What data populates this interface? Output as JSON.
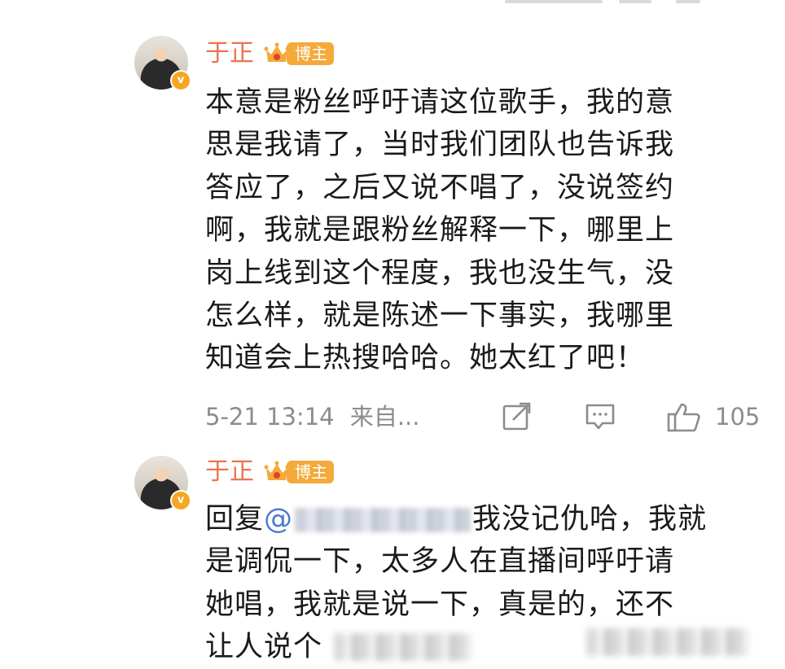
{
  "comments": [
    {
      "username": "于正",
      "badge_label": "博主",
      "text": "本意是粉丝呼吁请这位歌手，我的意思是我请了，当时我们团队也告诉我答应了，之后又说不唱了，没说签约啊，我就是跟粉丝解释一下，哪里上岗上线到这个程度，我也没生气，没怎么样，就是陈述一下事实，我哪里知道会上热搜哈哈。她太红了吧！",
      "lines": [
        "本意是粉丝呼吁请这位歌手，我的意",
        "思是我请了，当时我们团队也告诉我",
        "答应了，之后又说不唱了，没说签约",
        "啊，我就是跟粉丝解释一下，哪里上",
        "岗上线到这个程度，我也没生气，没",
        "怎么样，就是陈述一下事实，我哪里",
        "知道会上热搜哈哈。她太红了吧！"
      ],
      "time": "5-21 13:14",
      "source": "来自...",
      "like_count": "105",
      "icons": {
        "share": "share-icon",
        "comment": "comment-icon",
        "like": "like-icon"
      }
    },
    {
      "username": "于正",
      "badge_label": "博主",
      "reply_prefix": "回复",
      "at_symbol": "@",
      "lines": [
        "我没记仇哈，我就",
        "是调侃一下，太多人在直播间呼吁请",
        "她唱，我就是说一下，真是的，还不",
        "让人说个"
      ]
    }
  ],
  "colors": {
    "username": "#eb7350",
    "badge": "#f4a93a",
    "meta": "#8c8c8c",
    "text": "#1a1a1a",
    "at": "#4a7ad1"
  }
}
